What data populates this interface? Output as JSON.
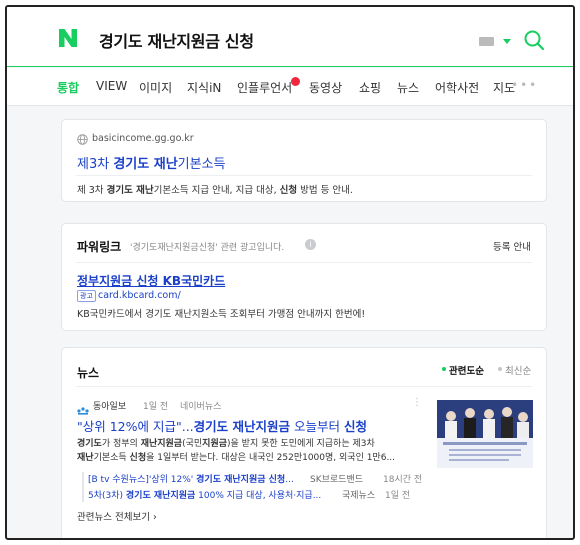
{
  "header": {
    "query": "경기도 재난지원금 신청"
  },
  "tabs": [
    {
      "label": "통합",
      "active": true
    },
    {
      "label": "VIEW"
    },
    {
      "label": "이미지"
    },
    {
      "label": "지식iN"
    },
    {
      "label": "인플루언서"
    },
    {
      "label": "동영상"
    },
    {
      "label": "쇼핑"
    },
    {
      "label": "뉴스"
    },
    {
      "label": "어학사전"
    },
    {
      "label": "지도"
    }
  ],
  "site_result": {
    "url": "basicincome.gg.go.kr",
    "title_pre": "제3차 ",
    "title_hl": "경기도 재난",
    "title_post": "기본소득",
    "desc_1": "제 3차 ",
    "desc_hl1": "경기도 재난",
    "desc_2": "기본소득 지급 안내, 지급 대상, ",
    "desc_hl2": "신청",
    "desc_3": " 방법 등 안내."
  },
  "powerlink": {
    "heading": "파워링크",
    "subtitle": "'경기도재난지원금신청' 관련 광고입니다.",
    "register_label": "등록 안내",
    "ad_title": "정부지원금 신청 KB국민카드",
    "ad_badge": "광고",
    "ad_url": "card.kbcard.com/",
    "ad_desc": "KB국민카드에서 경기도 재난지원소득 조회부터 가맹점 안내까지 한번에!"
  },
  "news": {
    "heading": "뉴스",
    "sort_relevance": "관련도순",
    "sort_latest": "최신순",
    "press": "동아일보",
    "press_time": "1일 전",
    "press_source": "네이버뉴스",
    "title_1": "\"상위 12%에 지급\"...",
    "title_hl": "경기도 재난지원금",
    "title_2": " 오늘부터 ",
    "title_hl2": "신청",
    "body_l1_hl": "경기도",
    "body_l1_a": "가 정부의 ",
    "body_l1_hl2": "재난지원금",
    "body_l1_b": "(국민",
    "body_l1_hl3": "지원금",
    "body_l1_c": ")을 받지 못한 도민에게 지급하는 제3차",
    "body_l2_hl": "재난",
    "body_l2_a": "기본소득 ",
    "body_l2_hl2": "신청",
    "body_l2_b": "을 1일부터 받는다. 대상은 내국인 252만1000명, 외국인 1만6...",
    "related": [
      {
        "pre": "[B tv 수원뉴스]'상위 12%' ",
        "hl": "경기도 재난지원금 신청",
        "post": "...",
        "source": "SK브로드밴드",
        "time": "18시간 전"
      },
      {
        "pre": "5차(3차) ",
        "hl": "경기도 재난지원금",
        "post": " 100% 지급 대상, 사용처·지급...",
        "source": "국제뉴스",
        "time": "1일 전"
      }
    ],
    "more_label": "관련뉴스 전체보기",
    "more_arrow": "›"
  },
  "colors": {
    "brand_green": "#19ce60",
    "link_blue": "#1b40c9",
    "badge_red": "#f0263e"
  }
}
